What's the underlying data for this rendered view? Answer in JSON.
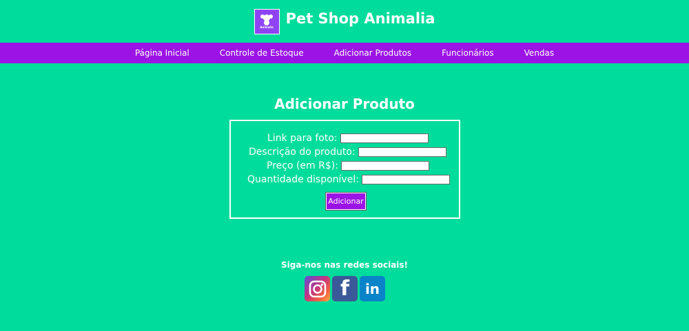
{
  "header": {
    "logo_text": "Animalia",
    "title": "Pet Shop Animalia"
  },
  "nav": {
    "items": [
      {
        "label": "Página Inicial"
      },
      {
        "label": "Controle de Estoque"
      },
      {
        "label": "Adicionar Produtos"
      },
      {
        "label": "Funcionários"
      },
      {
        "label": "Vendas"
      }
    ]
  },
  "main": {
    "title": "Adicionar Produto",
    "form": {
      "photo_label": "Link para foto:",
      "photo_value": "",
      "description_label": "Descrição do produto:",
      "description_value": "",
      "price_label": "Preço (em R$):",
      "price_value": "",
      "quantity_label": "Quantidade disponível:",
      "quantity_value": "",
      "submit_label": "Adicionar"
    }
  },
  "footer": {
    "follow_text": "Siga-nos nas redes sociais!",
    "social": {
      "instagram_icon": "instagram-icon",
      "facebook_glyph": "f",
      "linkedin_glyph": "in"
    }
  },
  "colors": {
    "background": "#00DC9B",
    "nav": "#9B14E5",
    "button": "#9B14E5",
    "logo": "#8E44F5"
  }
}
